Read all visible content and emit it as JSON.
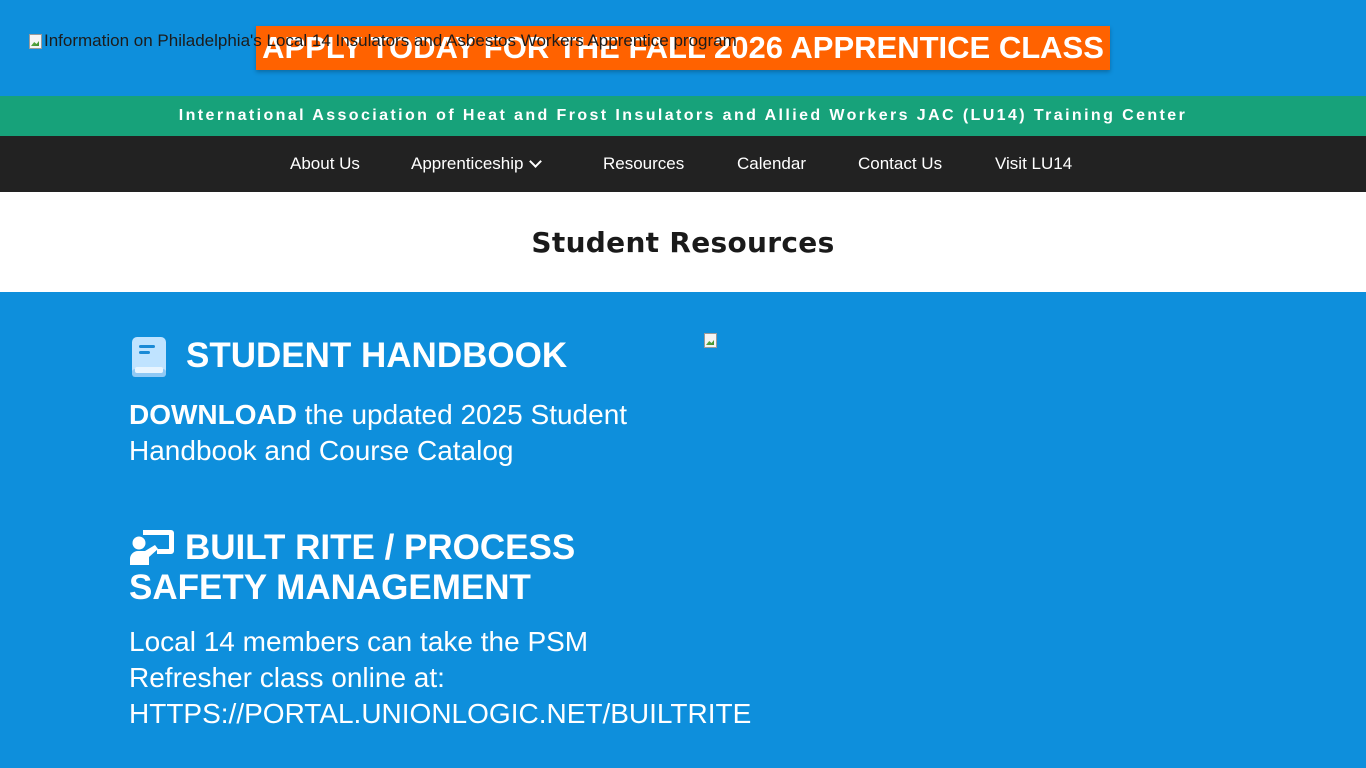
{
  "header": {
    "logo_alt": "Information on Philadelphia's Local 14 Insulators and Asbestos Workers Apprentice program",
    "cta_label": "APPLY TODAY FOR THE FALL 2026 APPRENTICE CLASS",
    "cta_color": "#ff6200"
  },
  "assoc_bar": {
    "text": "International Association of Heat and Frost Insulators and Allied Workers JAC (LU14) Training Center",
    "color": "#17a27a"
  },
  "nav": {
    "items": [
      {
        "label": "About Us"
      },
      {
        "label": "Apprenticeship",
        "icon": "chevron-down-icon"
      },
      {
        "label": "Resources"
      },
      {
        "label": "Calendar"
      },
      {
        "label": "Contact Us"
      },
      {
        "label": "Visit LU14"
      }
    ]
  },
  "page": {
    "title": "Student Resources"
  },
  "sections": {
    "handbook": {
      "icon": "book-icon",
      "heading": "STUDENT HANDBOOK",
      "download_label": "DOWNLOAD",
      "body_line1_rest": " the updated 2025 Student",
      "body_line2": "Handbook and Course Catalog"
    },
    "builtrite": {
      "icon": "chalkboard-teacher-icon",
      "heading_line1": "BUILT RITE / PROCESS",
      "heading_line2": "SAFETY MANAGEMENT",
      "body_line1": "Local 14 members can take the PSM",
      "body_line2": "Refresher class online at:",
      "link": "HTTPS://PORTAL.UNIONLOGIC.NET/BUILTRITE"
    }
  },
  "colors": {
    "background": "#0e8fdc",
    "nav_bg": "#222222"
  }
}
